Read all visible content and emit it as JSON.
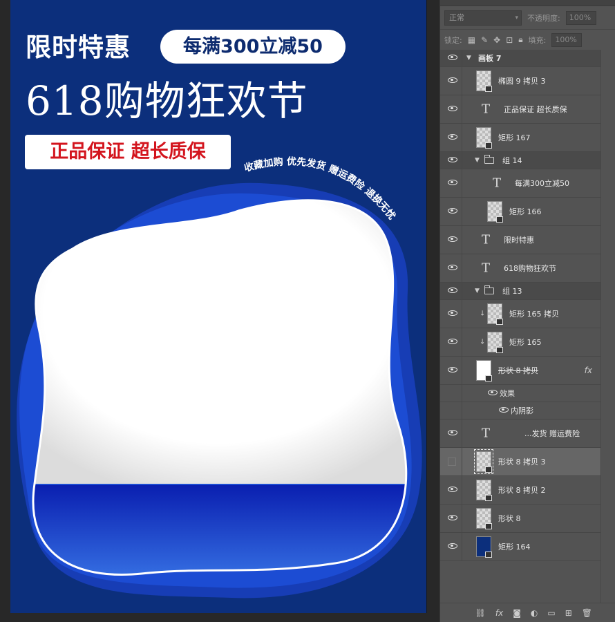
{
  "canvas": {
    "headline": "限时特惠",
    "promo_pill": "每满300立减50",
    "main_title": "618购物狂欢节",
    "guarantee_tag": "正品保证 超长质保",
    "arc_slogan": "收藏加购 优先发货 赠运费险 退换无忧"
  },
  "panel": {
    "blend_mode": "正常",
    "opacity_label": "不透明度:",
    "opacity_value": "100%",
    "lock_label": "锁定:",
    "fill_label": "填充:",
    "fill_value": "100%"
  },
  "layers": [
    {
      "name": "画板 7",
      "kind": "artboard"
    },
    {
      "name": "椭圆 9 拷贝 3",
      "kind": "thumb"
    },
    {
      "name": "正品保证 超长质保",
      "kind": "text"
    },
    {
      "name": "矩形 167",
      "kind": "thumb"
    },
    {
      "name": "组 14",
      "kind": "group"
    },
    {
      "name": "每满300立减50",
      "kind": "text"
    },
    {
      "name": "矩形 166",
      "kind": "thumb"
    },
    {
      "name": "限时特惠",
      "kind": "text"
    },
    {
      "name": "618购物狂欢节",
      "kind": "text"
    },
    {
      "name": "组 13",
      "kind": "group"
    },
    {
      "name": "矩形 165 拷贝",
      "kind": "thumb"
    },
    {
      "name": "矩形 165",
      "kind": "thumb"
    },
    {
      "name": "形状 8 拷贝",
      "kind": "thumb"
    },
    {
      "name": "效果",
      "kind": "effects"
    },
    {
      "name": "内阴影",
      "kind": "effect"
    },
    {
      "name": "...发货 赠运费险",
      "kind": "text"
    },
    {
      "name": "形状 8 拷贝 3",
      "kind": "thumb"
    },
    {
      "name": "形状 8 拷贝 2",
      "kind": "thumb"
    },
    {
      "name": "形状 8",
      "kind": "thumb"
    },
    {
      "name": "矩形 164",
      "kind": "thumb"
    }
  ],
  "footer_icons": [
    "link-icon",
    "fx-icon",
    "mask-icon",
    "adjustment-icon",
    "folder-icon",
    "new-layer-icon",
    "trash-icon"
  ],
  "colors": {
    "canvas_bg": "#0c2f7c",
    "accent_red": "#d3141d",
    "shape_blue": "#1a3fc0",
    "panel_bg": "#535353"
  }
}
